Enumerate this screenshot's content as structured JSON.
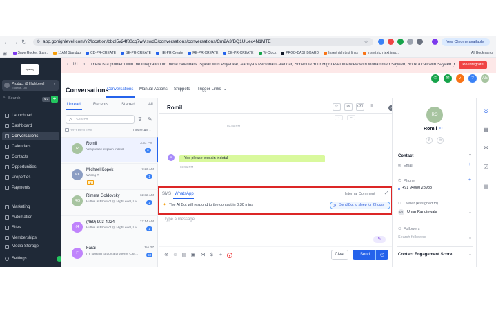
{
  "browser": {
    "url": "app.gohighlevel.com/v2/location/bbdl5v24f80cq7wMswdD/conversations/conversations/Cm2A3fBQ1UUec4N1MTE",
    "chrome_button": "New Chrome available",
    "bookmarks": [
      "SuperRocket Stan...",
      "11AM Standup",
      "CB-PR-CREATE",
      "SE-PR-CREATE",
      "HE-PR-Create",
      "RE-PR-CREATE",
      "CE-PR-CREATE",
      "W-Clock",
      "PROD-DASHBOARD",
      "Insert rich text links",
      "Insert rich text ima..."
    ],
    "all_bookmarks": "All Bookmarks"
  },
  "sidebar": {
    "logo": "Agency",
    "location_name": "Product @ HighLevel",
    "location_sub": "Eugene, OR",
    "search_label": "Search",
    "search_kbd": "⌘K",
    "items": [
      {
        "label": "Launchpad",
        "active": false
      },
      {
        "label": "Dashboard",
        "active": false
      },
      {
        "label": "Conversations",
        "active": true
      },
      {
        "label": "Calendars",
        "active": false
      },
      {
        "label": "Contacts",
        "active": false
      },
      {
        "label": "Opportunities",
        "active": false
      },
      {
        "label": "Properties",
        "active": false
      },
      {
        "label": "Payments",
        "active": false
      },
      {
        "label": "Marketing",
        "active": false
      },
      {
        "label": "Automation",
        "active": false
      },
      {
        "label": "Sites",
        "active": false
      },
      {
        "label": "Memberships",
        "active": false
      },
      {
        "label": "Media Storage",
        "active": false
      }
    ],
    "settings_label": "Settings"
  },
  "banner": {
    "pagination": "1/1",
    "message": "There is a problem with the integration on these calendars \"Speak with Priyanka!, Aaditya's Personal Calendar, Schedule Your HighLevel Interview with Mohammed Sayeed, Book a call with Sayeed [For...",
    "button": "Re-integrate"
  },
  "header": {
    "title": "Conversations",
    "tabs": [
      "Conversations",
      "Manual Actions",
      "Snippets",
      "Trigger Links"
    ],
    "avatar": "AE"
  },
  "list": {
    "tabs": [
      "Unread",
      "Recents",
      "Starred",
      "All"
    ],
    "search_placeholder": "Search",
    "results": "1311 RESULTS",
    "sort": "Latest-All",
    "conversations": [
      {
        "initials": "R",
        "name": "Romil",
        "preview": "Yes please explain indetal",
        "time": "3:51 PM",
        "badge": "6",
        "color": "#a7c4a0",
        "tag": ""
      },
      {
        "initials": "MK",
        "name": "Michael Kopek",
        "preview": "Wrong #",
        "time": "7:23 AM",
        "badge": "1",
        "color": "#8b9dc3",
        "tag": "1"
      },
      {
        "initials": "RG",
        "name": "Rimma Goldovsky",
        "preview": "Hi this is Product @ HighLevel, I w...",
        "time": "12:32 AM",
        "badge": "1",
        "color": "#a7c4a0",
        "tag": ""
      },
      {
        "initials": "(4",
        "name": "(469) 903-4024",
        "preview": "Hi this is Product @ HighLevel, I w...",
        "time": "12:14 AM",
        "badge": "1",
        "color": "#c084fc",
        "tag": ""
      },
      {
        "initials": "F",
        "name": "Farai",
        "preview": "I'm looking to buy a property. Can...",
        "time": "Jan 27",
        "badge": "58",
        "color": "#c084fc",
        "tag": ""
      }
    ]
  },
  "chat": {
    "name": "Romil",
    "time_top": "03:50 PM",
    "message_avatar": "R",
    "message": "Yes please explain indetal",
    "message_time": "03:51 PM",
    "composer": {
      "channel_sms": "SMS",
      "channel_whatsapp": "WhatsApp",
      "internal_comment": "Internal Comment",
      "bot_notice": "The AI Bot will respond to the contact in 0:30 mins",
      "sleep_button": "Send Bot to sleep for 2 hours",
      "placeholder": "Type a message"
    },
    "clear": "Clear",
    "send": "Send"
  },
  "contact": {
    "initials": "RO",
    "name": "Romil",
    "contact_section": "Contact",
    "email_label": "Email",
    "phone_label": "Phone",
    "phone_value": "+91 94080 28988",
    "owner_label": "Owner (Assigned to)",
    "owner_initials": "UR",
    "owner_value": "Umar Ranginwala",
    "followers_label": "Followers",
    "followers_placeholder": "Search followers",
    "engagement": "Contact Engagement Score"
  }
}
